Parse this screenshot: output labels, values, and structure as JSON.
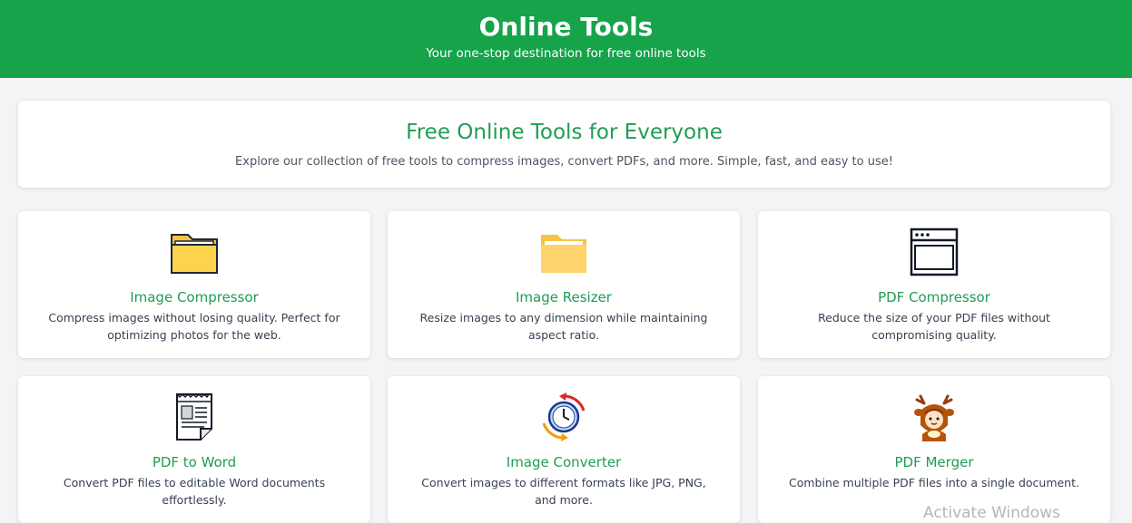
{
  "header": {
    "title": "Online Tools",
    "subtitle": "Your one-stop destination for free online tools",
    "bg_color": "#16a34a"
  },
  "hero": {
    "title": "Free Online Tools for Everyone",
    "text": "Explore our collection of free tools to compress images, convert PDFs, and more. Simple, fast, and easy to use!"
  },
  "tools": [
    {
      "title": "Image Compressor",
      "description": "Compress images without losing quality. Perfect for optimizing photos for the web.",
      "icon": "folder-icon"
    },
    {
      "title": "Image Resizer",
      "description": "Resize images to any dimension while maintaining aspect ratio.",
      "icon": "folder-light-icon"
    },
    {
      "title": "PDF Compressor",
      "description": "Reduce the size of your PDF files without compromising quality.",
      "icon": "window-icon"
    },
    {
      "title": "PDF to Word",
      "description": "Convert PDF files to editable Word documents effortlessly.",
      "icon": "document-icon"
    },
    {
      "title": "Image Converter",
      "description": "Convert images to different formats like JPG, PNG, and more.",
      "icon": "clock-refresh-icon"
    },
    {
      "title": "PDF Merger",
      "description": "Combine multiple PDF files into a single document.",
      "icon": "reindeer-avatar-icon"
    }
  ],
  "watermark": "Activate Windows",
  "accent_color": "#1f9d55"
}
